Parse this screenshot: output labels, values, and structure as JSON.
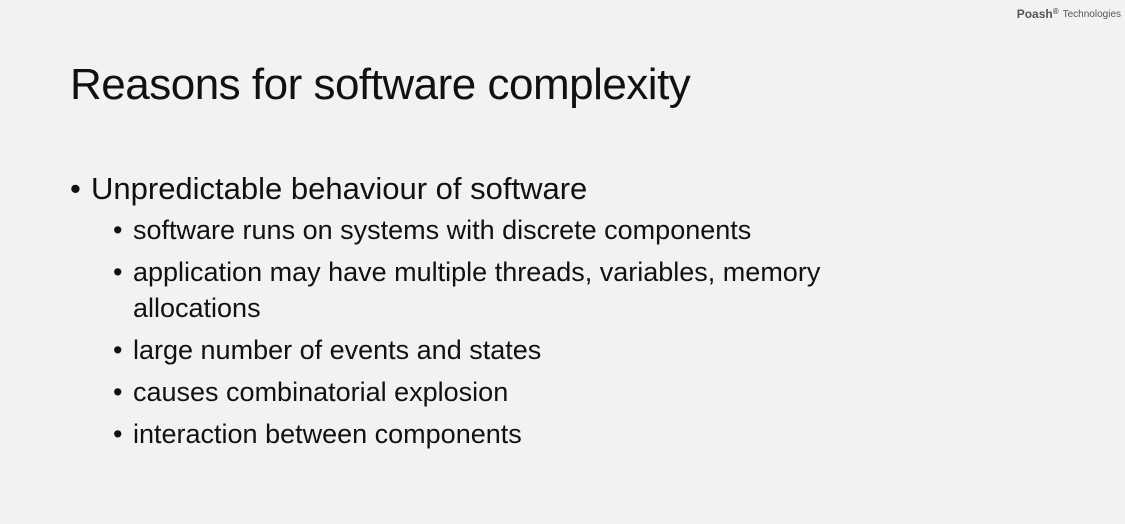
{
  "brand": {
    "name": "Poash",
    "reg": "®",
    "sub": "Technologies"
  },
  "slide": {
    "title": "Reasons for software complexity",
    "main_bullet": "Unpredictable behaviour of software",
    "sub_bullets": [
      "software runs on systems with discrete components",
      "application may have multiple threads, variables, memory allocations",
      "large number of events and states",
      "causes combinatorial explosion",
      "interaction between components"
    ]
  },
  "bullet_glyph": "•"
}
